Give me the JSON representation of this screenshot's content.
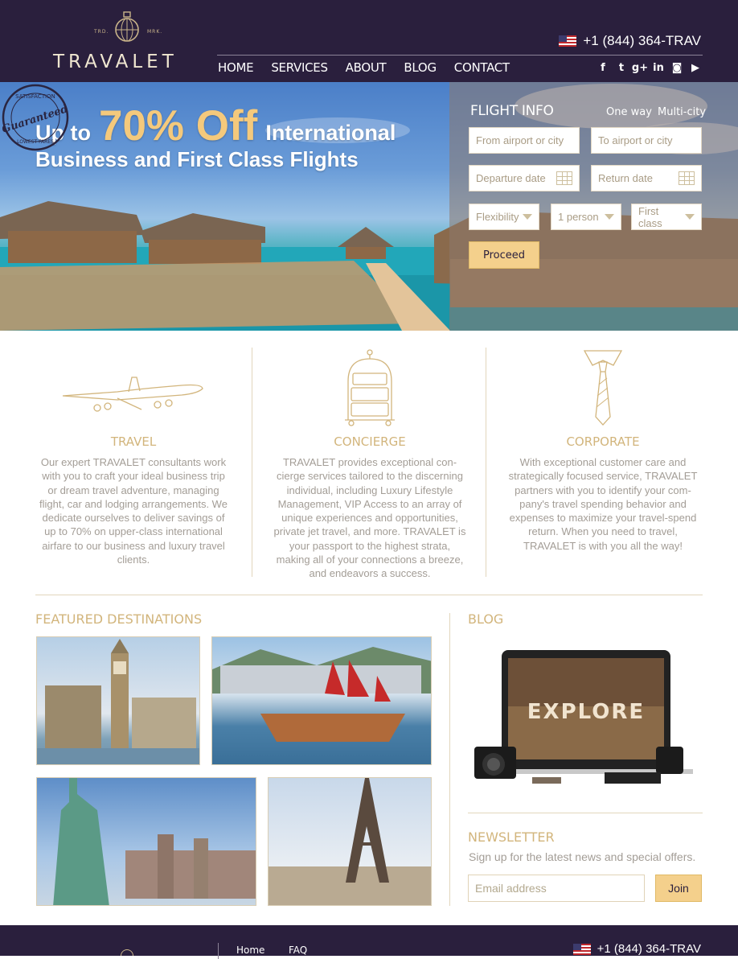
{
  "brand": {
    "logo_text": "TRAVALET",
    "tm_left": "TRD.",
    "tm_right": "MRK.",
    "phone": "+1 (844) 364-TRAV"
  },
  "nav": {
    "items": [
      {
        "label": "HOME"
      },
      {
        "label": "SERVICES"
      },
      {
        "label": "ABOUT"
      },
      {
        "label": "BLOG"
      },
      {
        "label": "CONTACT"
      }
    ]
  },
  "social": [
    {
      "icon": "facebook-icon",
      "glyph": "f"
    },
    {
      "icon": "twitter-icon",
      "glyph": "t"
    },
    {
      "icon": "google-plus-icon",
      "glyph": "g+"
    },
    {
      "icon": "linkedin-icon",
      "glyph": "in"
    },
    {
      "icon": "instagram-icon",
      "glyph": "◙"
    },
    {
      "icon": "youtube-icon",
      "glyph": "▶"
    }
  ],
  "hero": {
    "line1_prefix": "Up to",
    "line1_big": "70% Off",
    "line1_suffix": "International",
    "line2": "Business and First Class Flights",
    "stamp_top": "SATISFACTION",
    "stamp_mid": "Guaranteed",
    "stamp_bottom": "LOWEST FARES"
  },
  "flight_form": {
    "title": "FLIGHT INFO",
    "one_way": "One way",
    "multi_city": "Multi-city",
    "from_placeholder": "From airport or city",
    "to_placeholder": "To airport or city",
    "departure_placeholder": "Departure date",
    "return_placeholder": "Return date",
    "flexibility": "Flexibility",
    "passengers": "1 person",
    "cabin": "First class",
    "proceed": "Proceed"
  },
  "services": [
    {
      "title": "TRAVEL",
      "text": "Our expert TRAVALET consultants work with you to craft your ideal business trip or dream travel adventure, managing flight, car and lodging arrangements. We dedicate ourselves to deliver savings of up to 70% on upper-class international airfare to our business and luxury travel clients."
    },
    {
      "title": "CONCIERGE",
      "text": "TRAVALET provides exceptional con-cierge services tailored to the discerning individual, including Luxury Lifestyle Management, VIP Access to an array of unique experiences and opportunities, private jet travel, and more. TRAVALET is your passport to the highest strata, making all of your connections a breeze, and endeavors a success."
    },
    {
      "title": "CORPORATE",
      "text": "With exceptional customer care and strategically focused service, TRAVALET partners with you to identify your com-pany's travel spending behavior and expenses to maximize your travel-spend return. When you need to travel, TRAVALET is with you all the way!"
    }
  ],
  "featured": {
    "title": "FEATURED DESTINATIONS"
  },
  "blog": {
    "title": "BLOG",
    "screen_text": "EXPLORE"
  },
  "newsletter": {
    "title": "NEWSLETTER",
    "subtitle": "Sign up for the latest news and special offers.",
    "email_placeholder": "Email address",
    "join": "Join"
  },
  "footer": {
    "links": [
      {
        "label": "Home"
      },
      {
        "label": "FAQ"
      }
    ],
    "phone": "+1 (844) 364-TRAV"
  },
  "colors": {
    "header_bg": "#2a1f3d",
    "accent_gold": "#d2b57c",
    "button_gold": "#f4d08c",
    "body_text": "#a39d96"
  }
}
